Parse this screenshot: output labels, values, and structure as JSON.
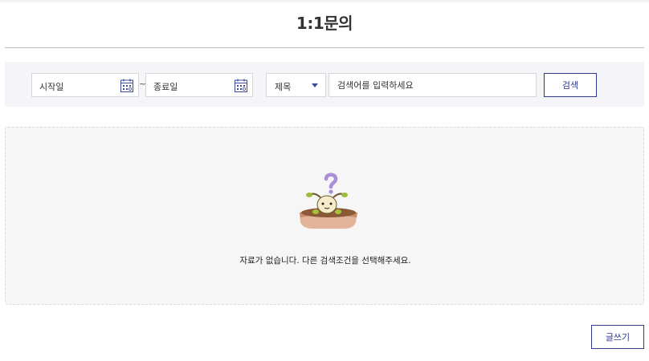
{
  "header": {
    "title": "1:1문의"
  },
  "search": {
    "start_date_placeholder": "시작일",
    "date_separator": "~",
    "end_date_placeholder": "종료일",
    "field_select_value": "제목",
    "keyword_placeholder": "검색어를 입력하세요",
    "search_button_label": "검색"
  },
  "empty_state": {
    "message": "자료가 없습니다. 다른 검색조건을 선택해주세요."
  },
  "actions": {
    "write_button_label": "글쓰기"
  },
  "colors": {
    "accent": "#2d3a8c",
    "search_bg": "#f5f5f9",
    "empty_bg": "#f6f6f6"
  }
}
